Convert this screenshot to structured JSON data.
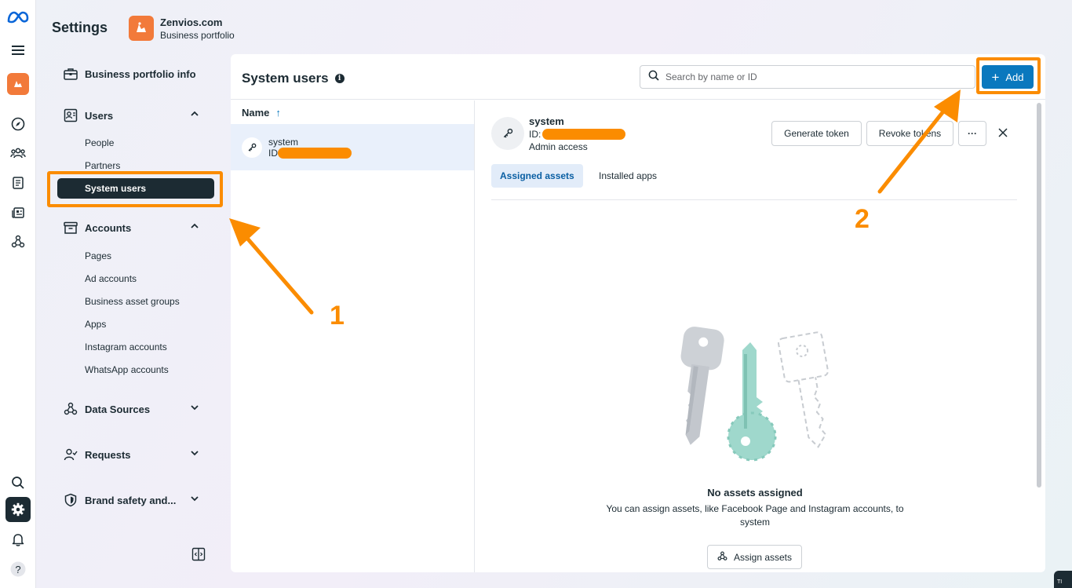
{
  "header": {
    "title": "Settings",
    "business_name": "Zenvios.com",
    "business_subtitle": "Business portfolio"
  },
  "rail": {
    "icons": [
      "meta-logo-icon",
      "menu-icon",
      "business-avatar-icon",
      "compass-icon",
      "people-group-icon",
      "book-icon",
      "news-feed-icon",
      "data-sources-icon",
      "search-icon",
      "gear-icon",
      "bell-icon",
      "help-icon"
    ]
  },
  "nav": {
    "portfolio_info": "Business portfolio info",
    "users": {
      "label": "Users",
      "items": [
        "People",
        "Partners",
        "System users"
      ]
    },
    "accounts": {
      "label": "Accounts",
      "items": [
        "Pages",
        "Ad accounts",
        "Business asset groups",
        "Apps",
        "Instagram accounts",
        "WhatsApp accounts"
      ]
    },
    "data_sources": "Data Sources",
    "requests": "Requests",
    "brand_safety": "Brand safety and..."
  },
  "main": {
    "title": "System users",
    "search_placeholder": "Search by name or ID",
    "add_label": "Add",
    "list": {
      "column_header": "Name",
      "rows": [
        {
          "name": "system",
          "id_label": "ID"
        }
      ]
    },
    "detail": {
      "name": "system",
      "id_label": "ID:",
      "access": "Admin access",
      "generate_token": "Generate token",
      "revoke_tokens": "Revoke tokens",
      "more": "···",
      "tabs": [
        "Assigned assets",
        "Installed apps"
      ],
      "empty_title": "No assets assigned",
      "empty_subtitle": "You can assign assets, like Facebook Page and Instagram accounts, to system",
      "assign_label": "Assign assets"
    }
  },
  "annotations": {
    "step1": "1",
    "step2": "2",
    "color": "#fb8c00"
  },
  "corner_badge": "TI"
}
